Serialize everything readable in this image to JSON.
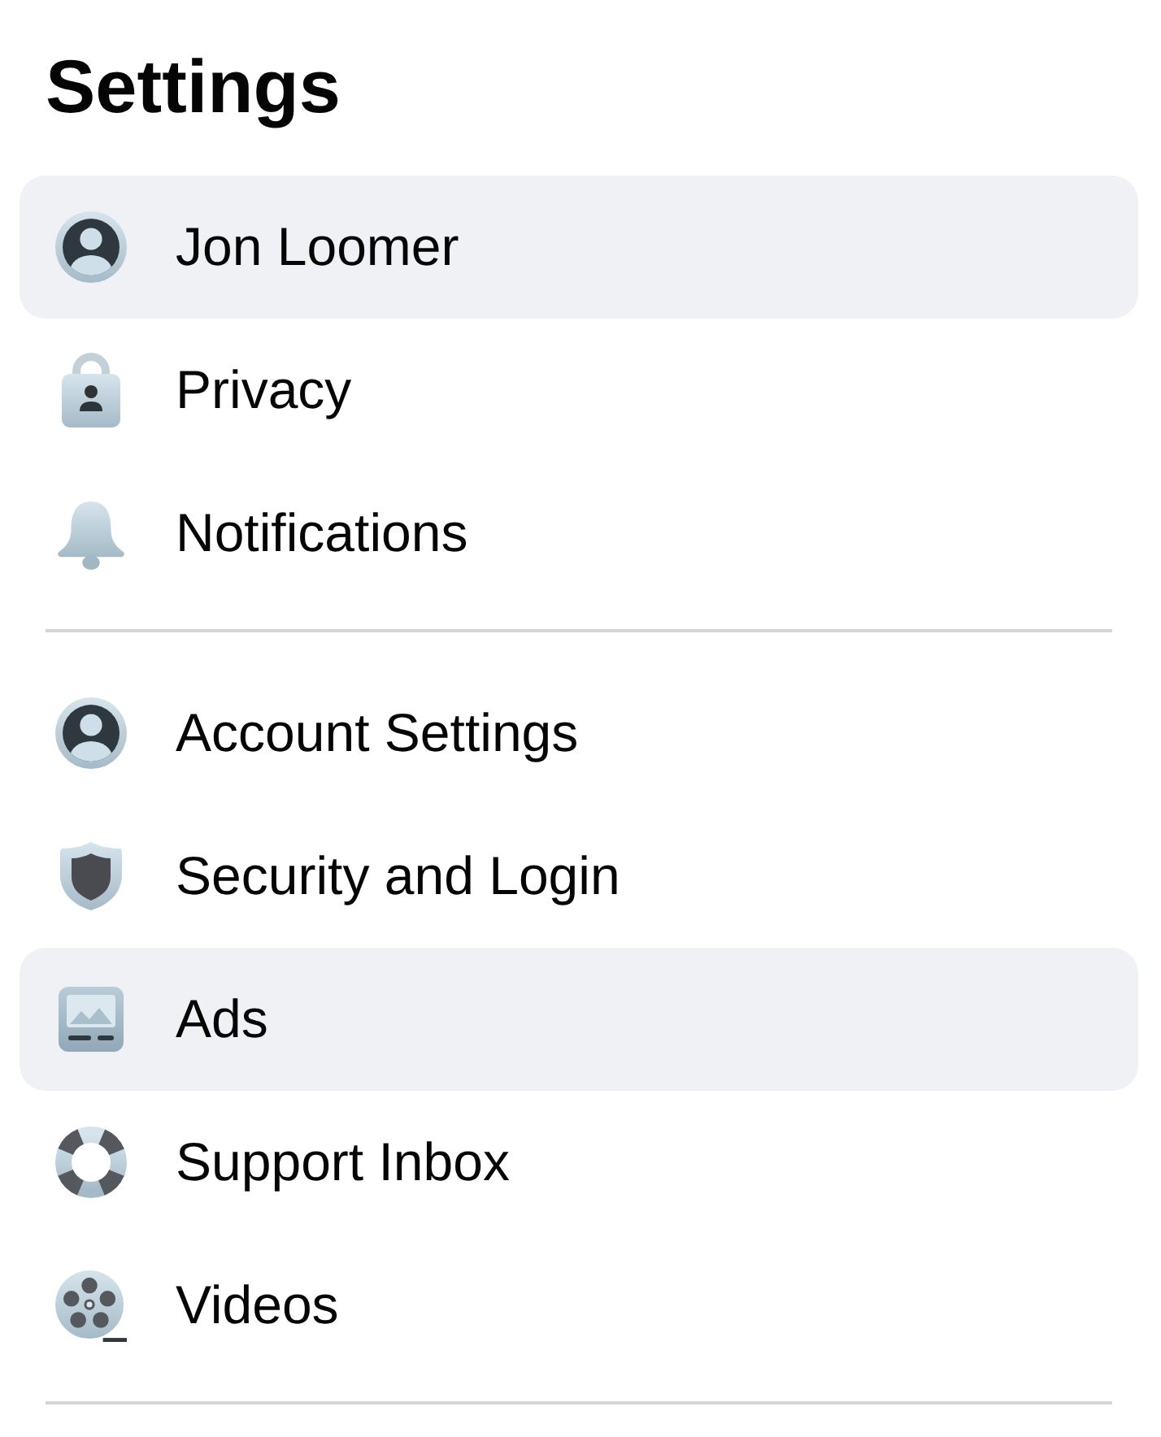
{
  "title": "Settings",
  "sections": [
    {
      "items": [
        {
          "label": "Jon Loomer",
          "kind": "profile",
          "highlighted": true
        },
        {
          "label": "Privacy",
          "kind": "lock",
          "highlighted": false
        },
        {
          "label": "Notifications",
          "kind": "bell",
          "highlighted": false
        }
      ]
    },
    {
      "items": [
        {
          "label": "Account Settings",
          "kind": "profile",
          "highlighted": false
        },
        {
          "label": "Security and Login",
          "kind": "shield",
          "highlighted": false
        },
        {
          "label": "Ads",
          "kind": "ads",
          "highlighted": true
        },
        {
          "label": "Support Inbox",
          "kind": "lifebuoy",
          "highlighted": false
        },
        {
          "label": "Videos",
          "kind": "reel",
          "highlighted": false
        }
      ]
    }
  ]
}
